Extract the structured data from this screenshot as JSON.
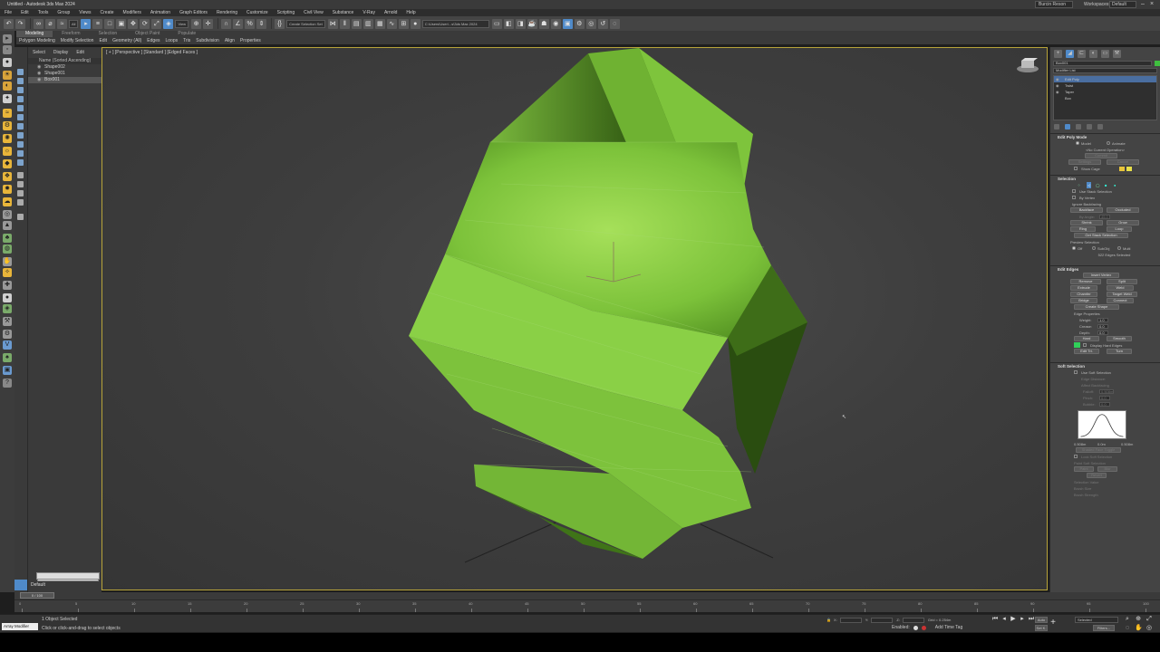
{
  "window": {
    "title": "Untitled - Autodesk 3ds Max 2024",
    "user": "Burcin Reson",
    "workspaces_label": "Workspaces:",
    "workspace": "Default"
  },
  "menu": [
    "File",
    "Edit",
    "Tools",
    "Group",
    "Views",
    "Create",
    "Modifiers",
    "Animation",
    "Graph Editors",
    "Rendering",
    "Customize",
    "Scripting",
    "Civil View",
    "Substance",
    "V-Ray",
    "Arnold",
    "Help"
  ],
  "toolbar": {
    "filter": "All",
    "view": "View",
    "selection_set": "Create Selection Set",
    "project_path": "C:\\Users\\User\\...s\\3ds Max 2024"
  },
  "ribbon": {
    "tabs": [
      "Modeling",
      "Freeform",
      "Selection",
      "Object Paint",
      "Populate"
    ],
    "active_tab": "Modeling",
    "items": [
      "Polygon Modeling",
      "Modify Selection",
      "Edit",
      "Geometry (All)",
      "Edges",
      "Loops",
      "Tris",
      "Subdivision",
      "Align",
      "Properties"
    ]
  },
  "explorer": {
    "tabs": [
      "Select",
      "Display",
      "Edit"
    ],
    "header": "Name (Sorted Ascending)",
    "items": [
      {
        "name": "Shape002",
        "selected": false
      },
      {
        "name": "Shape001",
        "selected": false
      },
      {
        "name": "Box001",
        "selected": true
      }
    ]
  },
  "viewport": {
    "label": "[ + ] [Perspective ] [Standard ] [Edged Faces ]",
    "model_color": "#7fc43a"
  },
  "command_panel": {
    "object_name": "Box001",
    "object_color": "#3fbf3f",
    "modifier_list": "Modifier List",
    "stack": [
      {
        "name": "Edit Poly",
        "selected": true
      },
      {
        "name": "Twist",
        "selected": false
      },
      {
        "name": "Taper",
        "selected": false
      },
      {
        "name": "Box",
        "selected": false
      }
    ],
    "edit_poly_mode": {
      "title": "Edit Poly Mode",
      "model": "Model",
      "animate": "Animate",
      "no_op": "<No Current Operation>",
      "commit": "Commit",
      "settings": "Settings",
      "cancel": "Cancel",
      "show_cage": "Show Cage"
    },
    "selection": {
      "title": "Selection",
      "use_stack": "Use Stack Selection",
      "by_vertex": "By Vertex",
      "ignore_backfacing": "Ignore Backfacing",
      "backface": "Backface",
      "occluded": "Occluded",
      "by_angle": "By Angle:",
      "by_angle_value": "45.0",
      "shrink": "Shrink",
      "grow": "Grow",
      "ring": "Ring",
      "loop": "Loop",
      "get_stack": "Get Stack Selection",
      "preview": "Preview Selection",
      "off": "Off",
      "subobj": "SubObj",
      "multi": "Multi",
      "count": "522 Edges Selected"
    },
    "edit_edges": {
      "title": "Edit Edges",
      "insert_vertex": "Insert Vertex",
      "remove": "Remove",
      "split": "Split",
      "extrude": "Extrude",
      "weld": "Weld",
      "chamfer": "Chamfer",
      "target_weld": "Target Weld",
      "bridge": "Bridge",
      "connect": "Connect",
      "create_shape": "Create Shape",
      "edge_props": "Edge Properties",
      "weight": "Weight:",
      "weight_value": "1.0",
      "crease": "Crease:",
      "crease_value": "0.0",
      "depth": "Depth:",
      "depth_value": "0.0",
      "hard": "Hard",
      "smooth": "Smooth",
      "display_hard": "Display Hard Edges",
      "display_color": "#31d05a",
      "edit_tri": "Edit Tri.",
      "turn": "Turn"
    },
    "soft_selection": {
      "title": "Soft Selection",
      "use_soft": "Use Soft Selection",
      "edge_distance": "Edge Distance:",
      "affect_backfacing": "Affect Backfacing",
      "falloff": "Falloff:",
      "falloff_value": "0.508m",
      "pinch": "Pinch:",
      "pinch_value": "0.0",
      "bubble": "Bubble:",
      "bubble_value": "0.0",
      "curve_left": "0.508m",
      "curve_mid": "0.0m",
      "curve_right": "0.508m",
      "shaded_face": "Shaded Face Toggle",
      "lock": "Lock Soft Selection",
      "paint_soft": "Paint Soft Selection",
      "paint": "Paint",
      "blur": "Blur",
      "revert": "Revert",
      "selection_value": "Selection Value",
      "brush_size": "Brush Size",
      "brush_strength": "Brush Strength"
    }
  },
  "timeline": {
    "knob": "0 / 100",
    "ticks": [
      "0",
      "5",
      "10",
      "15",
      "20",
      "25",
      "30",
      "35",
      "40",
      "45",
      "50",
      "55",
      "60",
      "65",
      "70",
      "75",
      "80",
      "85",
      "90",
      "95",
      "100"
    ]
  },
  "status": {
    "maxscript": "Array Modifier",
    "selected": "1 Object Selected",
    "prompt": "Click or click-and-drag to select objects",
    "x_label": "X:",
    "y_label": "Y:",
    "z_label": "Z:",
    "grid": "Grid = 0.254m",
    "enabled": "Enabled:",
    "add_time_tag": "Add Time Tag",
    "auto": "Auto",
    "selected_drop": "Selected",
    "set_key": "Set K.",
    "filters": "Filters...",
    "layer": "Default"
  }
}
